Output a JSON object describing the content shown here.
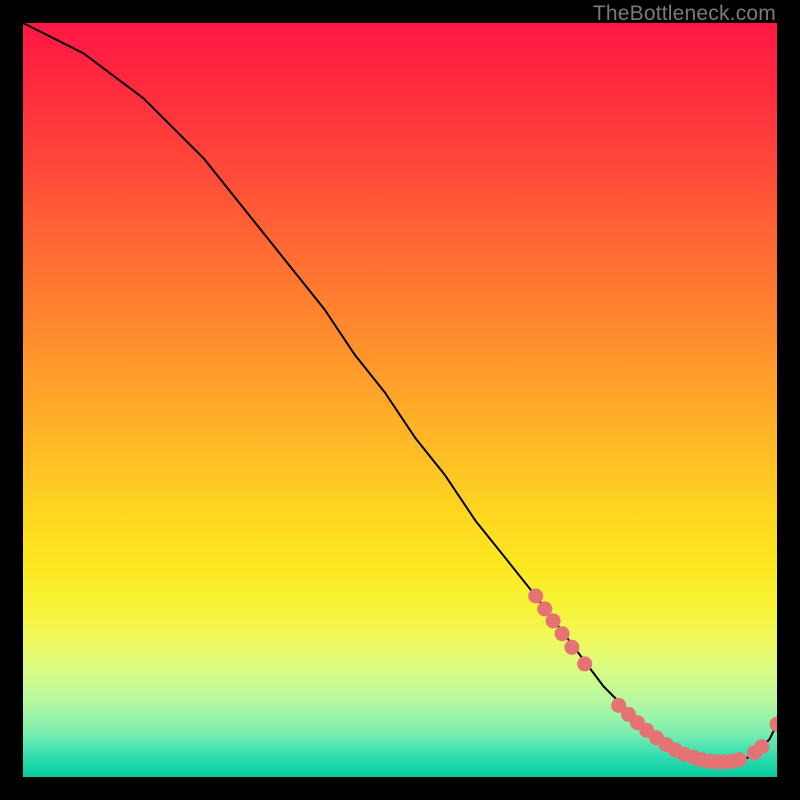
{
  "watermark": "TheBottleneck.com",
  "chart_data": {
    "type": "line",
    "title": "",
    "xlabel": "",
    "ylabel": "",
    "xlim": [
      0,
      100
    ],
    "ylim": [
      0,
      100
    ],
    "grid": false,
    "series": [
      {
        "name": "curve",
        "color": "#000000",
        "x": [
          0,
          4,
          8,
          12,
          16,
          20,
          24,
          28,
          32,
          36,
          40,
          44,
          48,
          52,
          56,
          60,
          64,
          68,
          71,
          74,
          77,
          80,
          83,
          86,
          89,
          91,
          93,
          95,
          97,
          99,
          100
        ],
        "y": [
          100,
          98,
          96,
          93,
          90,
          86,
          82,
          77,
          72,
          67,
          62,
          56,
          51,
          45,
          40,
          34,
          29,
          24,
          20,
          16,
          12,
          9,
          6,
          4,
          3,
          2,
          2,
          2,
          3,
          5,
          7
        ]
      }
    ],
    "markers": {
      "name": "dots",
      "color": "#e57373",
      "radius": 1.0,
      "points": [
        {
          "x": 68.0,
          "y": 24.0
        },
        {
          "x": 69.2,
          "y": 22.3
        },
        {
          "x": 70.3,
          "y": 20.7
        },
        {
          "x": 71.5,
          "y": 19.0
        },
        {
          "x": 72.8,
          "y": 17.2
        },
        {
          "x": 74.5,
          "y": 15.0
        },
        {
          "x": 79.0,
          "y": 9.5
        },
        {
          "x": 80.3,
          "y": 8.3
        },
        {
          "x": 81.5,
          "y": 7.2
        },
        {
          "x": 82.7,
          "y": 6.2
        },
        {
          "x": 84.0,
          "y": 5.2
        },
        {
          "x": 85.3,
          "y": 4.3
        },
        {
          "x": 86.5,
          "y": 3.6
        },
        {
          "x": 87.7,
          "y": 3.0
        },
        {
          "x": 89.0,
          "y": 2.6
        },
        {
          "x": 90.0,
          "y": 2.3
        },
        {
          "x": 91.0,
          "y": 2.1
        },
        {
          "x": 92.0,
          "y": 2.0
        },
        {
          "x": 93.0,
          "y": 2.0
        },
        {
          "x": 94.0,
          "y": 2.1
        },
        {
          "x": 95.0,
          "y": 2.3
        },
        {
          "x": 97.0,
          "y": 3.2
        },
        {
          "x": 98.0,
          "y": 4.0
        },
        {
          "x": 100.0,
          "y": 7.0
        }
      ]
    },
    "gradient_stops": [
      {
        "pos": 0.0,
        "color": "#ff1744"
      },
      {
        "pos": 0.5,
        "color": "#ffc107"
      },
      {
        "pos": 0.78,
        "color": "#fdf53a"
      },
      {
        "pos": 1.0,
        "color": "#0bc79a"
      }
    ]
  }
}
